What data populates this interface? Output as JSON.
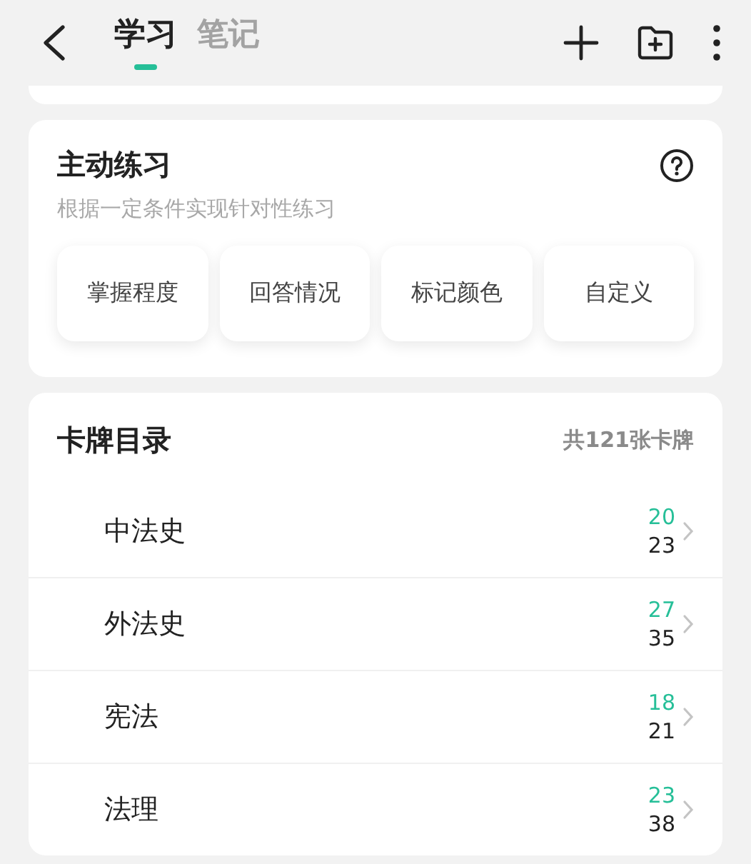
{
  "tabs": [
    {
      "label": "学习",
      "selected": true
    },
    {
      "label": "笔记",
      "selected": false
    }
  ],
  "practice": {
    "title": "主动练习",
    "subtitle": "根据一定条件实现针对性练习",
    "options": [
      "掌握程度",
      "回答情况",
      "标记颜色",
      "自定义"
    ]
  },
  "catalog": {
    "title": "卡牌目录",
    "count": "共121张卡牌",
    "rows": [
      {
        "name": "中法史",
        "learned": "20",
        "total": "23"
      },
      {
        "name": "外法史",
        "learned": "27",
        "total": "35"
      },
      {
        "name": "宪法",
        "learned": "18",
        "total": "21"
      },
      {
        "name": "法理",
        "learned": "23",
        "total": "38"
      }
    ]
  }
}
